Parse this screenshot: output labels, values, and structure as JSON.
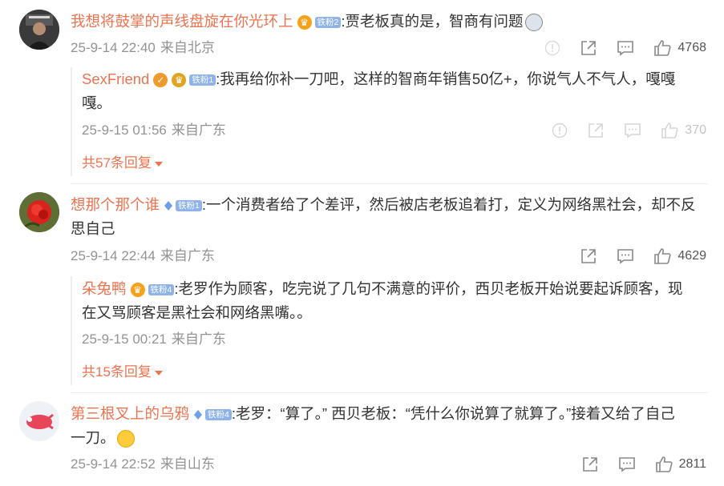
{
  "comments": [
    {
      "username": "我想将鼓掌的声线盘旋在你光环上",
      "fan_badge": "铁粉2",
      "text": ":贾老板真的是，智商有问题",
      "emoji": "shocked-emoji",
      "date": "25-9-14 22:40",
      "location": "来自北京",
      "likes": "4768",
      "reply": {
        "username": "SexFriend",
        "fan_badge": "铁粉1",
        "text_line1": ":我再给你补一刀吧，这样的智商年销售50亿+，你说气人不气人，嘎嘎",
        "text_line2": "嘎。",
        "date": "25-9-15 01:56",
        "location": "来自广东",
        "likes": "370"
      },
      "more_replies": "共57条回复"
    },
    {
      "username": "想那个那个谁",
      "fan_badge": "铁粉1",
      "text_line1": ":一个消费者给了个差评，然后被店老板追着打，定义为网络黑社会，却不反",
      "text_line2": "思自己",
      "date": "25-9-14 22:44",
      "location": "来自广东",
      "likes": "4629",
      "reply": {
        "username": "朵兔鸭",
        "fan_badge": "铁粉4",
        "text_line1": ":老罗作为顾客，吃完说了几句不满意的评价，西贝老板开始说要起诉顾客，现",
        "text_line2": "在又骂顾客是黑社会和网络黑嘴。。",
        "date": "25-9-15 00:21",
        "location": "来自广东"
      },
      "more_replies": "共15条回复"
    },
    {
      "username": "第三根叉上的乌鸦",
      "fan_badge": "铁粉4",
      "text_line1": ":老罗：“算了。” 西贝老板：“凭什么你说算了就算了。”接着又给了自己",
      "text_line2": "一刀。",
      "emoji": "laughing-tears-emoji",
      "date": "25-9-14 22:52",
      "location": "来自山东",
      "likes": "2811"
    }
  ],
  "colors": {
    "username": "#eb7350",
    "meta": "#939393",
    "text": "#333333",
    "badge": "#8fb3e8"
  }
}
